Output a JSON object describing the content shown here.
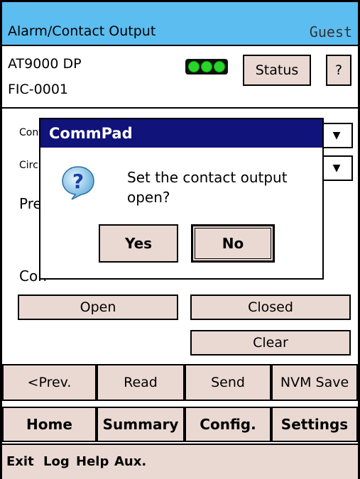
{
  "title": {
    "text": "Alarm/Contact Output",
    "user": "Guest"
  },
  "device": {
    "model": "AT9000 DP",
    "tag": "FIC-0001",
    "status_label": "Status",
    "help_label": "?"
  },
  "content": {
    "label1": "Cont",
    "label2": "Circu",
    "label3": "Pres",
    "label4": "Con",
    "open_label": "Open",
    "closed_label": "Closed",
    "clear_label": "Clear"
  },
  "dialog": {
    "title": "CommPad",
    "message_line1": "Set the contact output",
    "message_line2": "open?",
    "yes_label": "Yes",
    "no_label": "No"
  },
  "nav": {
    "prev": "<Prev.",
    "read": "Read",
    "send": "Send",
    "nvm": "NVM Save"
  },
  "tabs": {
    "home": "Home",
    "summary": "Summary",
    "config": "Config.",
    "settings": "Settings"
  },
  "menu": {
    "exit": "Exit",
    "log": "Log",
    "help": "Help",
    "aux": "Aux."
  },
  "colors": {
    "titlebar": "#5cbdf0",
    "button": "#ead9d3",
    "dialog_title": "#10137a",
    "led": "#2ad42a"
  }
}
